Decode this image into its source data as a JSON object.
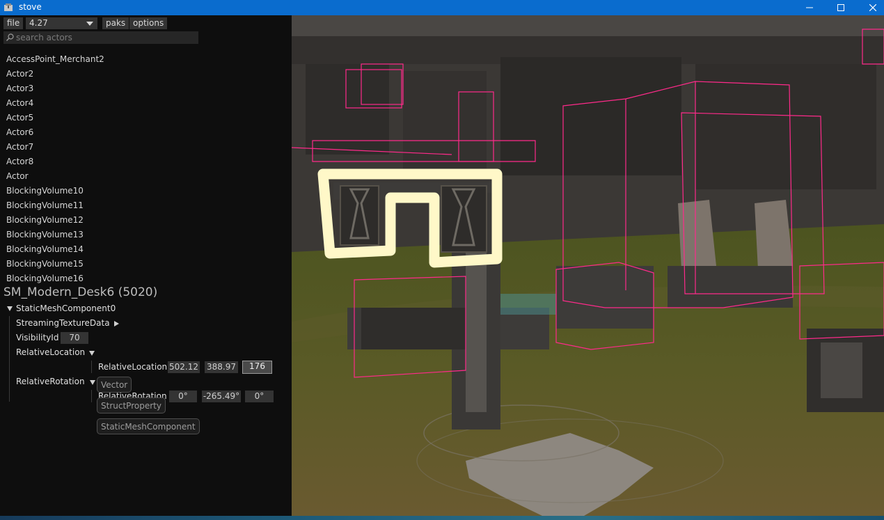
{
  "window": {
    "title": "stove"
  },
  "toolbar": {
    "file_label": "file",
    "version_value": "4.27",
    "paks_label": "paks",
    "options_label": "options"
  },
  "search": {
    "placeholder": "search actors"
  },
  "actors": [
    "AccessPoint_Merchant2",
    "Actor2",
    "Actor3",
    "Actor4",
    "Actor5",
    "Actor6",
    "Actor7",
    "Actor8",
    "Actor",
    "BlockingVolume10",
    "BlockingVolume11",
    "BlockingVolume12",
    "BlockingVolume13",
    "BlockingVolume14",
    "BlockingVolume15",
    "BlockingVolume16"
  ],
  "selection": {
    "title": "SM_Modern_Desk6 (5020)",
    "component": "StaticMeshComponent0",
    "streaming_label": "StreamingTextureData",
    "visibility_label": "VisibilityId",
    "visibility_value": "70",
    "rel_loc_label": "RelativeLocation",
    "rel_loc_inner_label": "RelativeLocation",
    "rel_loc_values": [
      "502.12",
      "388.97",
      "176"
    ],
    "rel_rot_label": "RelativeRotation",
    "rel_rot_inner_label": "RelativeRotation",
    "rel_rot_values": [
      "0°",
      "-265.49°",
      "0°"
    ]
  },
  "tooltips": {
    "type": "Vector",
    "property": "StructProperty",
    "owner": "StaticMeshComponent"
  },
  "colors": {
    "titlebar": "#0a6cce",
    "panel": "#0e0e0e",
    "highlight": "#fff8c8",
    "bounds": "#ff2a8a"
  },
  "icons": {
    "app": "package-icon",
    "search": "magnifier-icon",
    "minimize": "minimize-icon",
    "maximize": "maximize-icon",
    "close": "close-icon"
  }
}
